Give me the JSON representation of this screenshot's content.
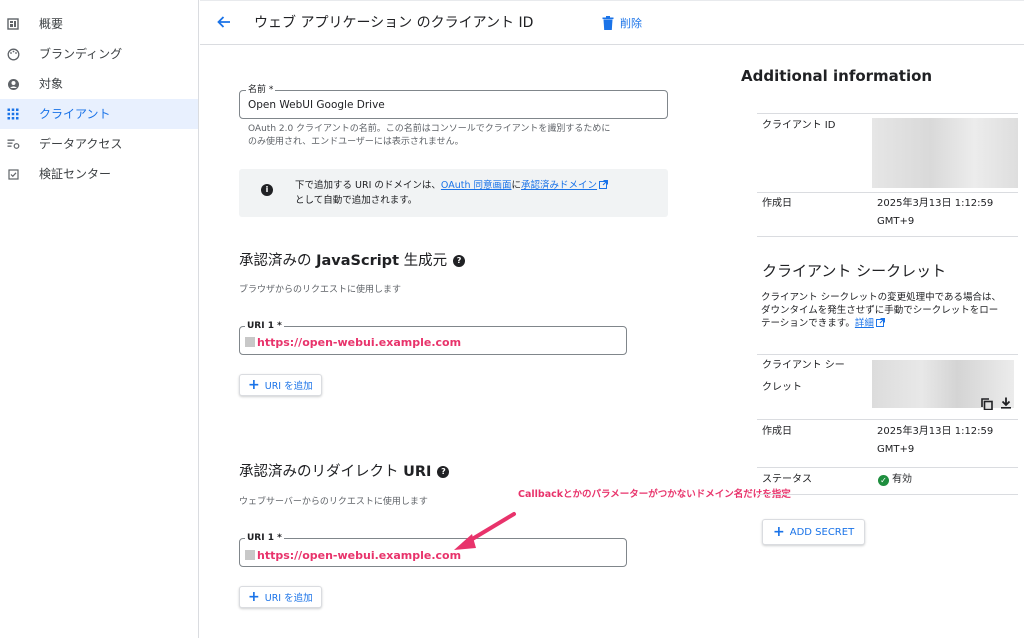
{
  "sidebar": {
    "items": [
      {
        "label": "概要",
        "icon": "dashboard-icon",
        "active": false
      },
      {
        "label": "ブランディング",
        "icon": "palette-icon",
        "active": false
      },
      {
        "label": "対象",
        "icon": "account-circle-icon",
        "active": false
      },
      {
        "label": "クライアント",
        "icon": "apps-grid-icon",
        "active": true
      },
      {
        "label": "データアクセス",
        "icon": "data-settings-icon",
        "active": false
      },
      {
        "label": "検証センター",
        "icon": "check-box-icon",
        "active": false
      }
    ]
  },
  "header": {
    "title": "ウェブ アプリケーション のクライアント ID",
    "delete_label": "削除"
  },
  "form": {
    "name_label": "名前 *",
    "name_value": "Open WebUI Google Drive",
    "name_helper_line1": "OAuth 2.0 クライアントの名前。この名前はコンソールでクライアントを識別するために",
    "name_helper_line2": "のみ使用され、エンドユーザーには表示されません。",
    "info": {
      "part1": "下で追加する URI のドメインは、",
      "link1": "OAuth 同意画面",
      "part2": "に",
      "link2": "承認済みドメイン",
      "part3": "として自動で追加されます。"
    },
    "js_origins": {
      "title_prefix": "承認済みの ",
      "title_bold": "JavaScript",
      "title_suffix": " 生成元",
      "helper": "ブラウザからのリクエストに使用します",
      "uri_label": "URI 1 *",
      "uri_value": "https://open-webui.example.com",
      "add_label": "URI を追加"
    },
    "redirect_uris": {
      "title_prefix": "承認済みのリダイレクト ",
      "title_bold": "URI",
      "helper": "ウェブサーバーからのリクエストに使用します",
      "uri_label": "URI 1 *",
      "uri_value": "https://open-webui.example.com",
      "add_label": "URI を追加"
    }
  },
  "additional": {
    "title": "Additional information",
    "client_id_label": "クライアント ID",
    "created_label": "作成日",
    "created_value_line1": "2025年3月13日 1:12:59",
    "created_value_line2": "GMT+9"
  },
  "secret": {
    "title": "クライアント シークレット",
    "desc_line1": "クライアント シークレットの変更処理中である場合は、",
    "desc_line2": "ダウンタイムを発生させずに手動でシークレットをロー",
    "desc_line3": "テーションできます。",
    "desc_link": "詳細",
    "secret_label_line1": "クライアント シー",
    "secret_label_line2": "クレット",
    "created_label": "作成日",
    "created_value_line1": "2025年3月13日 1:12:59",
    "created_value_line2": "GMT+9",
    "status_label": "ステータス",
    "status_value": "有効",
    "add_secret_label": "ADD SECRET"
  },
  "annotation": {
    "text": "Callbackとかのパラメーターがつかないドメイン名だけを指定",
    "color": "#e8336b"
  },
  "colors": {
    "accent": "#1a73e8",
    "active_bg": "#e8f0fe",
    "status_green": "#1e8e3e"
  }
}
